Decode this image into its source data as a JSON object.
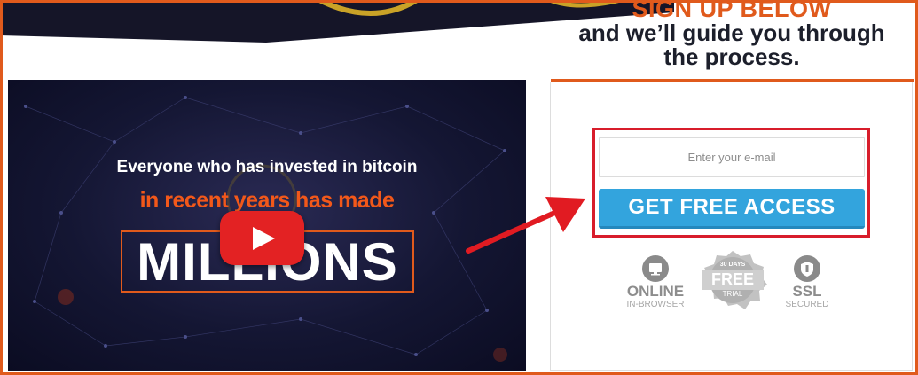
{
  "heading": {
    "line1": "SIGN UP BELOW",
    "line2": "and we’ll guide you through",
    "line3": "the process."
  },
  "video": {
    "line1": "Everyone who has invested in bitcoin",
    "line2": "in recent years has made",
    "highlight": "MILLIONS",
    "play_icon": "youtube-play-icon"
  },
  "form": {
    "email_placeholder": "Enter your e-mail",
    "submit_label": "GET FREE ACCESS"
  },
  "badges": {
    "online": {
      "title": "ONLINE",
      "subtitle": "IN-BROWSER",
      "icon": "monitor-icon"
    },
    "free": {
      "top": "30 DAYS",
      "title": "FREE",
      "subtitle": "TRIAL",
      "icon": "seal-icon"
    },
    "ssl": {
      "title": "SSL",
      "subtitle": "SECURED",
      "icon": "shield-icon"
    }
  },
  "colors": {
    "accent_orange": "#e05a1c",
    "highlight_red": "#d81d2b",
    "button_blue": "#33a4dd",
    "dark_navy": "#1c1f2b",
    "youtube_red": "#e32223"
  }
}
